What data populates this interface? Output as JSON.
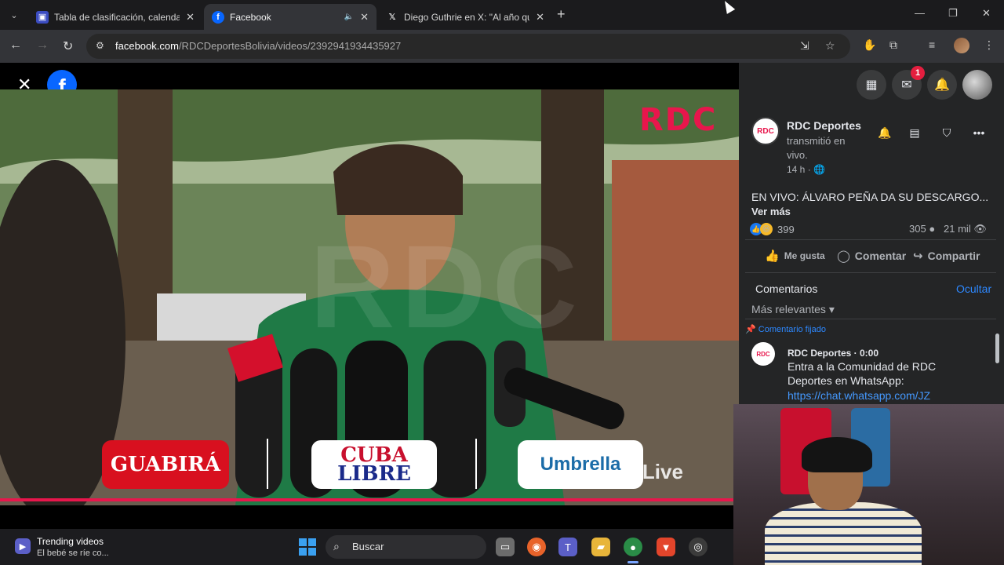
{
  "browser": {
    "tabs": [
      {
        "title": "Tabla de clasificación, calendari",
        "favicon": "doc-icon",
        "active": false
      },
      {
        "title": "Facebook",
        "favicon": "facebook-icon",
        "active": true,
        "audio": true
      },
      {
        "title": "Diego Guthrie en X: \"Al año qu",
        "favicon": "x-icon",
        "active": false
      }
    ],
    "new_tab": "+",
    "url": {
      "host": "facebook.com",
      "path": "/RDCDeportesBolivia/videos/2392941934435927"
    }
  },
  "video": {
    "channel_bug": "RDC",
    "sponsors": {
      "guabira": "GUABIRÁ",
      "cuba_line1": "CUBA",
      "cuba_line2": "LIBRE",
      "umbrella": "Umbrella",
      "live_tag": "M Live"
    }
  },
  "post": {
    "page_name": "RDC Deportes",
    "subtitle": "transmitió en vivo.",
    "time": "14 h ·",
    "text": "EN VIVO: ÁLVARO PEÑA DA SU DESCARGO...",
    "see_more": "Ver más",
    "reaction_count": "399",
    "comment_count": "305",
    "views": "21 mil",
    "actions": {
      "like": "Me gusta",
      "comment": "Comentar",
      "share": "Compartir"
    },
    "messenger_badge": "1"
  },
  "comments": {
    "header": "Comentarios",
    "hide": "Ocultar",
    "sort": "Más relevantes ▾",
    "pinned_label": "Comentario fijado",
    "items": [
      {
        "author": "RDC Deportes · 0:00",
        "body": "Entra a la Comunidad de RDC Deportes en WhatsApp:",
        "link": "https://chat.whatsapp.com/JZ"
      }
    ]
  },
  "taskbar": {
    "widget_title": "Trending videos",
    "widget_sub": "El bebé se ríe co...",
    "search_placeholder": "Buscar"
  },
  "colors": {
    "accent": "#e8164c",
    "fb_blue": "#0866ff",
    "link": "#2d88ff"
  }
}
